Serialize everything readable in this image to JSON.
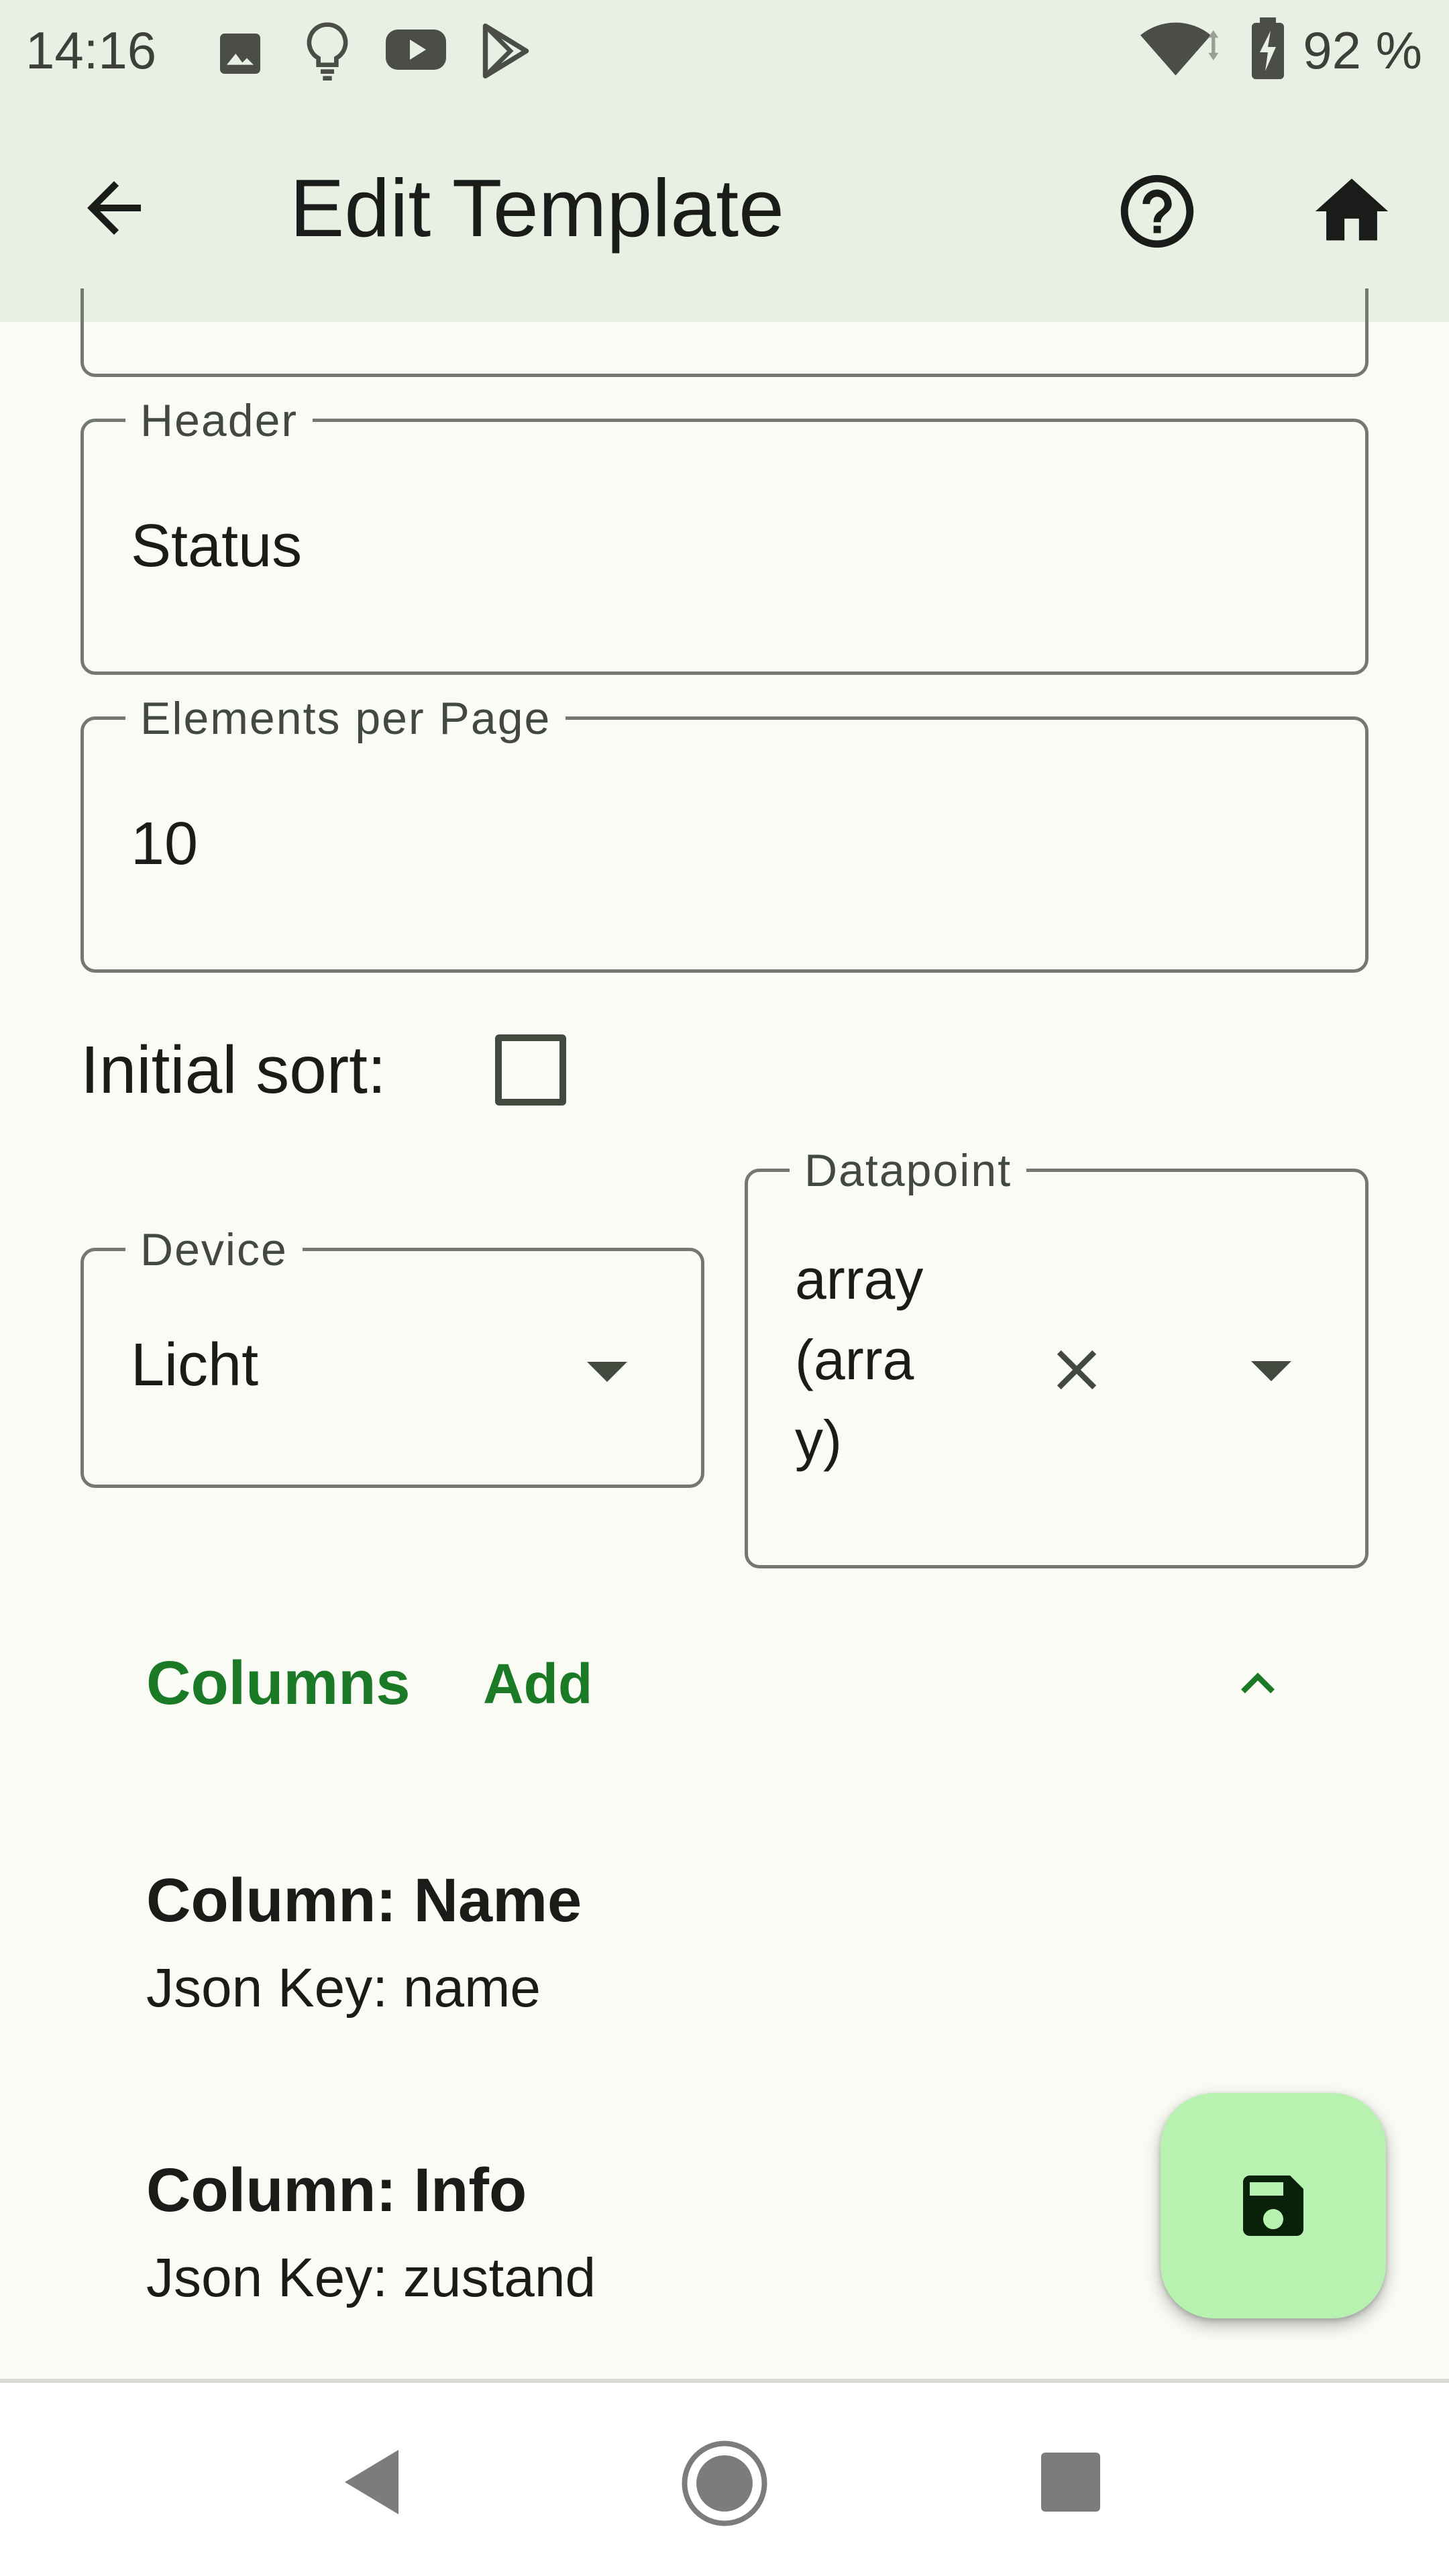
{
  "status_bar": {
    "time": "14:16",
    "battery": "92 %",
    "icons": [
      "image-icon",
      "lightbulb-icon",
      "youtube-icon",
      "play-store-icon",
      "wifi-icon",
      "battery-charging-icon"
    ]
  },
  "app_bar": {
    "title": "Edit Template",
    "back_icon": "arrow-back-icon",
    "help_icon": "help-circle-icon",
    "home_icon": "home-icon"
  },
  "form": {
    "header_field": {
      "label": "Header",
      "value": "Status"
    },
    "elements_field": {
      "label": "Elements per Page",
      "value": "10"
    },
    "initial_sort": {
      "label": "Initial sort:",
      "checked": false
    },
    "device_field": {
      "label": "Device",
      "value": "Licht"
    },
    "datapoint_field": {
      "label": "Datapoint",
      "value_lines": [
        "array",
        "(arra",
        "y)"
      ]
    }
  },
  "columns": {
    "title": "Columns",
    "add_label": "Add",
    "items": [
      {
        "title": "Column: Name",
        "subtitle": "Json Key: name"
      },
      {
        "title": "Column: Info",
        "subtitle": "Json Key: zustand"
      }
    ]
  },
  "fab": {
    "icon": "save-icon"
  },
  "nav_bar": {
    "icons": [
      "nav-back-icon",
      "nav-home-icon",
      "nav-recents-icon"
    ]
  },
  "colors": {
    "accent": "#1b7a25",
    "app_bar_bg": "#e9f0e3",
    "background": "#f9fbf4",
    "fab_bg": "#b7f2b1",
    "outline": "#73796f"
  }
}
